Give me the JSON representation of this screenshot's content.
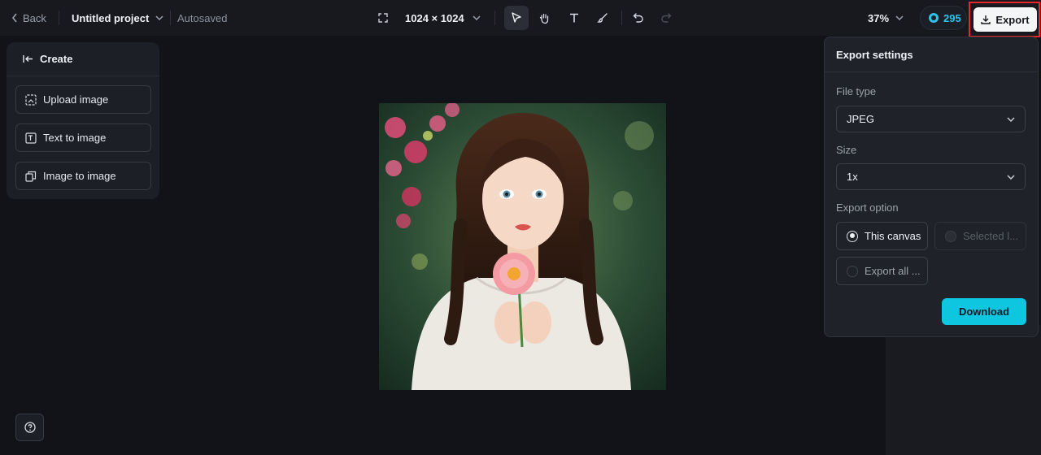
{
  "header": {
    "back_label": "Back",
    "project_title": "Untitled project",
    "save_status": "Autosaved",
    "canvas_size": "1024 × 1024",
    "zoom": "37%",
    "credits": "295",
    "export_label": "Export"
  },
  "create_panel": {
    "title": "Create",
    "items": [
      {
        "label": "Upload image",
        "icon": "upload-image-icon"
      },
      {
        "label": "Text to image",
        "icon": "text-to-image-icon"
      },
      {
        "label": "Image to image",
        "icon": "image-to-image-icon"
      }
    ]
  },
  "export_settings": {
    "title": "Export settings",
    "file_type_label": "File type",
    "file_type_value": "JPEG",
    "size_label": "Size",
    "size_value": "1x",
    "export_option_label": "Export option",
    "options": [
      {
        "label": "This canvas",
        "selected": true,
        "disabled": false
      },
      {
        "label": "Selected l...",
        "selected": false,
        "disabled": true
      },
      {
        "label": "Export all ...",
        "selected": false,
        "disabled": false
      }
    ],
    "download_label": "Download"
  },
  "colors": {
    "accent": "#0fc6e0",
    "highlight": "#e8272b",
    "background": "#111318"
  }
}
